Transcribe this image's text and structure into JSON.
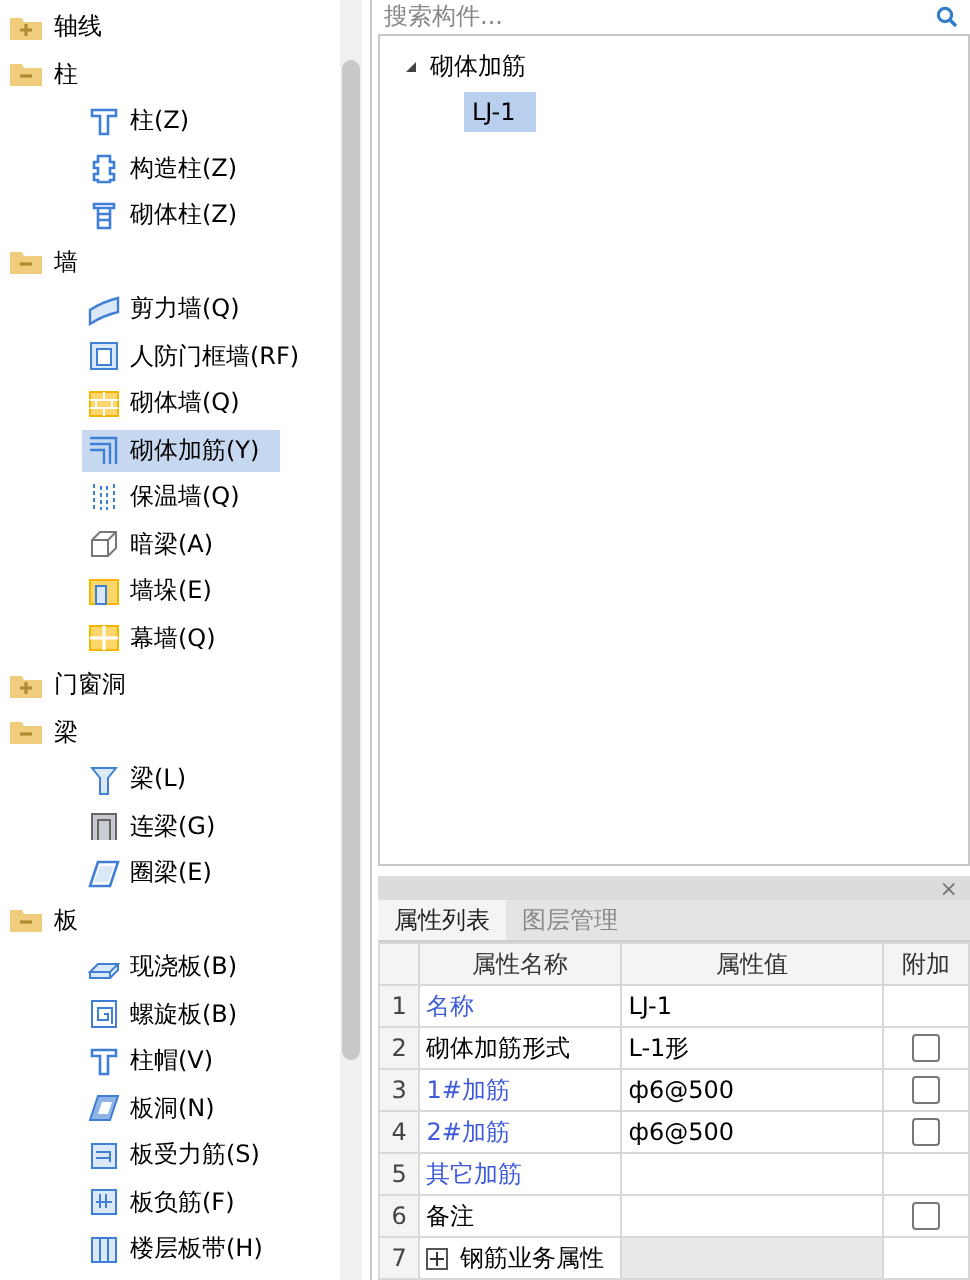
{
  "component_tree": {
    "categories": [
      {
        "label": "轴线",
        "expanded": false
      },
      {
        "label": "柱",
        "expanded": true,
        "children": [
          {
            "label": "柱(Z)",
            "kind": "column",
            "selected": false
          },
          {
            "label": "构造柱(Z)",
            "kind": "structural-column",
            "selected": false
          },
          {
            "label": "砌体柱(Z)",
            "kind": "masonry-column",
            "selected": false
          }
        ]
      },
      {
        "label": "墙",
        "expanded": true,
        "children": [
          {
            "label": "剪力墙(Q)",
            "kind": "shear-wall",
            "selected": false
          },
          {
            "label": "人防门框墙(RF)",
            "kind": "frame-wall",
            "selected": false
          },
          {
            "label": "砌体墙(Q)",
            "kind": "brick-wall",
            "selected": false
          },
          {
            "label": "砌体加筋(Y)",
            "kind": "rebar",
            "selected": true
          },
          {
            "label": "保温墙(Q)",
            "kind": "insulation",
            "selected": false
          },
          {
            "label": "暗梁(A)",
            "kind": "hidden-beam",
            "selected": false
          },
          {
            "label": "墙垛(E)",
            "kind": "pier",
            "selected": false
          },
          {
            "label": "幕墙(Q)",
            "kind": "curtain",
            "selected": false
          }
        ]
      },
      {
        "label": "门窗洞",
        "expanded": false
      },
      {
        "label": "梁",
        "expanded": true,
        "children": [
          {
            "label": "梁(L)",
            "kind": "beam",
            "selected": false
          },
          {
            "label": "连梁(G)",
            "kind": "link-beam",
            "selected": false
          },
          {
            "label": "圈梁(E)",
            "kind": "ring-beam",
            "selected": false
          }
        ]
      },
      {
        "label": "板",
        "expanded": true,
        "children": [
          {
            "label": "现浇板(B)",
            "kind": "slab",
            "selected": false
          },
          {
            "label": "螺旋板(B)",
            "kind": "spiral",
            "selected": false
          },
          {
            "label": "柱帽(V)",
            "kind": "column",
            "selected": false
          },
          {
            "label": "板洞(N)",
            "kind": "slab-hole",
            "selected": false
          },
          {
            "label": "板受力筋(S)",
            "kind": "slab-rebar",
            "selected": false
          },
          {
            "label": "板负筋(F)",
            "kind": "slab-neg",
            "selected": false
          },
          {
            "label": "楼层板带(H)",
            "kind": "band",
            "selected": false
          }
        ]
      }
    ]
  },
  "search": {
    "placeholder": "搜索构件..."
  },
  "instance_tree": {
    "group": "砌体加筋",
    "expanded": true,
    "items": [
      {
        "label": "LJ-1",
        "selected": true
      }
    ]
  },
  "property_panel": {
    "close": "×",
    "tabs": [
      {
        "label": "属性列表",
        "selected": true
      },
      {
        "label": "图层管理",
        "selected": false
      }
    ],
    "columns": [
      "属性名称",
      "属性值",
      "附加"
    ],
    "rows": [
      {
        "number": "1",
        "name": "名称",
        "public": true,
        "value": "LJ-1",
        "kind": "attr"
      },
      {
        "number": "2",
        "name": "砌体加筋形式",
        "public": false,
        "value": "L-1形",
        "kind": "attr",
        "extra_checked": false
      },
      {
        "number": "3",
        "name": "1#加筋",
        "public": true,
        "value": "ф6@500",
        "kind": "attr",
        "extra_checked": false
      },
      {
        "number": "4",
        "name": "2#加筋",
        "public": true,
        "value": "ф6@500",
        "kind": "attr",
        "extra_checked": false
      },
      {
        "number": "5",
        "name": "其它加筋",
        "public": true,
        "value": "",
        "kind": "attr"
      },
      {
        "number": "6",
        "name": "备注",
        "public": false,
        "value": "",
        "kind": "attr",
        "extra_checked": false
      },
      {
        "number": "7",
        "name": "钢筋业务属性",
        "expanded": false,
        "kind": "group"
      }
    ]
  }
}
